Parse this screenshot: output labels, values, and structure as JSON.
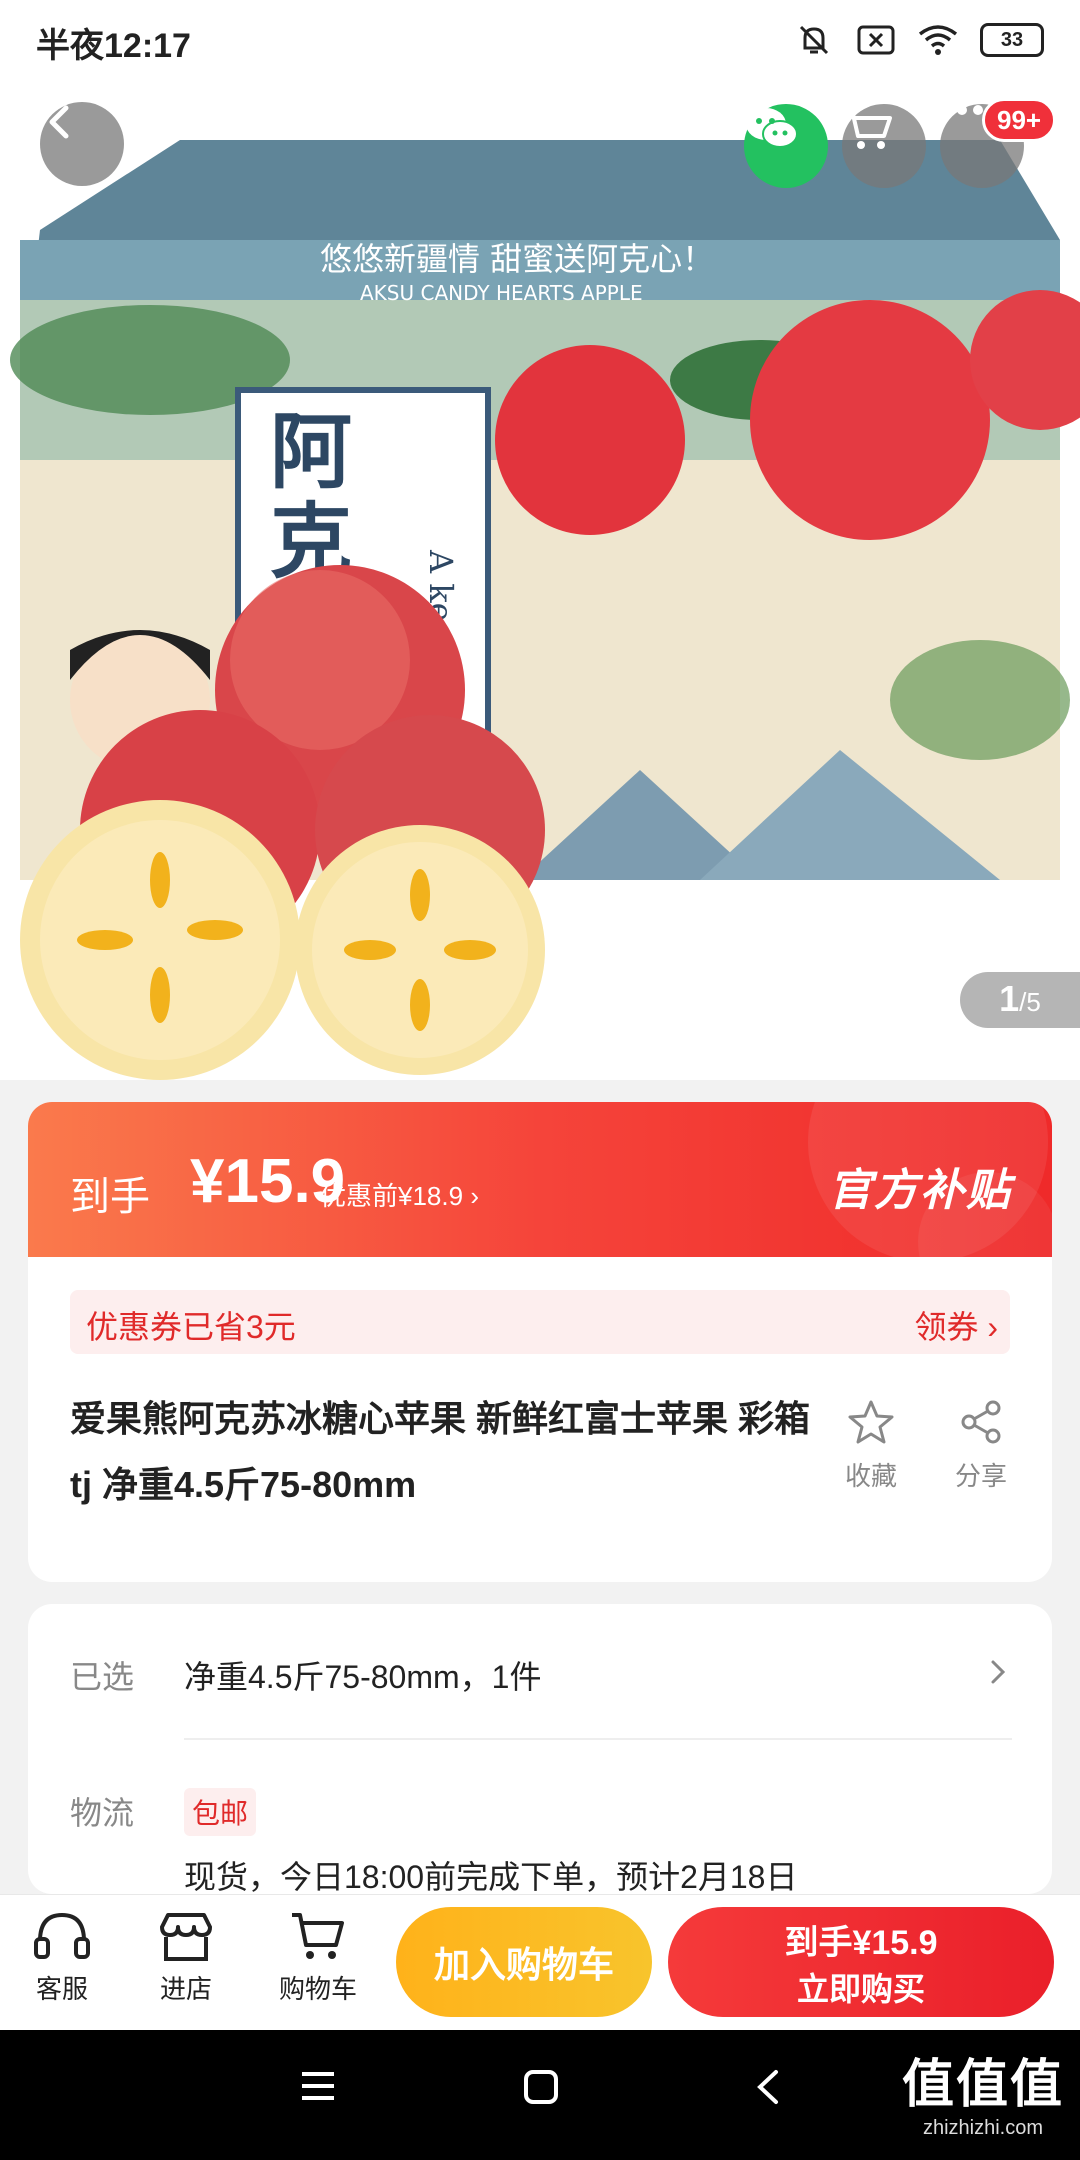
{
  "status": {
    "time": "半夜12:17",
    "battery": "33"
  },
  "hero": {
    "box_title_cn": "悠悠新疆情 甜蜜送阿克心！",
    "box_title_en": "AKSU CANDY HEARTS APPLE",
    "box_label_cn": "阿克苏",
    "box_label_en": "A ke su",
    "pager_current": "1",
    "pager_total": "/5",
    "badge": "99+"
  },
  "price": {
    "label": "到手",
    "value": "¥15.9",
    "original": "优惠前¥18.9",
    "official_tag": "官方补贴"
  },
  "coupon": {
    "text": "优惠券已省3元",
    "action": "领券"
  },
  "product": {
    "title": "爱果熊阿克苏冰糖心苹果 新鲜红富士苹果 彩箱tj 净重4.5斤75-80mm",
    "fav_label": "收藏",
    "share_label": "分享"
  },
  "spec": {
    "selected_label": "已选",
    "selected_value": "净重4.5斤75-80mm，1件",
    "logistics_label": "物流",
    "free_shipping": "包邮",
    "logistics_value": "现货，今日18:00前完成下单，预计2月18日"
  },
  "bottom": {
    "service": "客服",
    "store": "进店",
    "cart": "购物车",
    "add_cart": "加入购物车",
    "buy_line1": "到手¥15.9",
    "buy_line2": "立即购买"
  },
  "watermark": {
    "top": "值值值",
    "url": "zhizhizhi.com"
  },
  "colors": {
    "accent_red": "#f0303a",
    "accent_orange": "#ffb21a",
    "wechat_green": "#23c160"
  }
}
